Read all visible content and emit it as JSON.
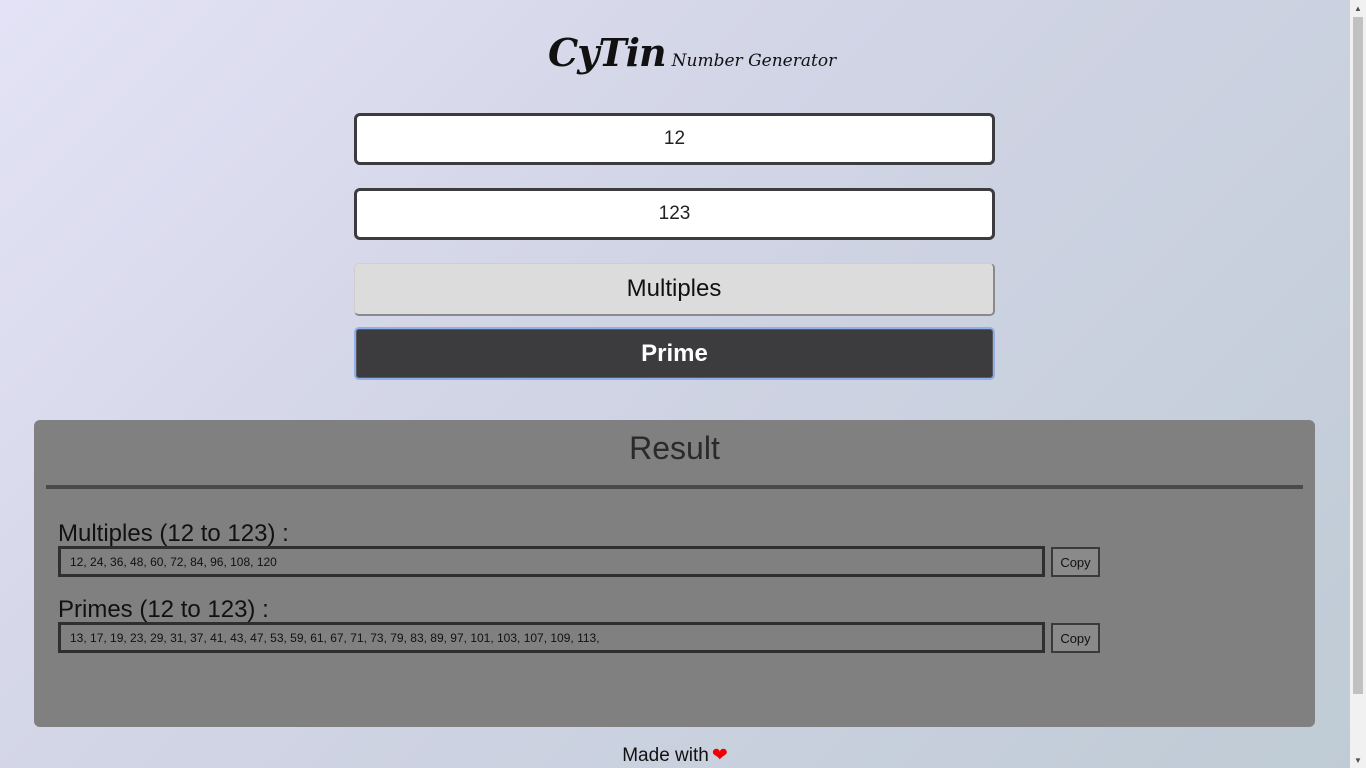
{
  "header": {
    "logo_main": "CyTin",
    "logo_sub": "Number Generator"
  },
  "form": {
    "start_value": "12",
    "end_value": "123",
    "multiples_label": "Multiples",
    "prime_label": "Prime"
  },
  "result": {
    "title": "Result",
    "multiples_label": "Multiples (12 to 123) :",
    "multiples_value": "12, 24, 36, 48, 60, 72, 84, 96, 108, 120",
    "primes_label": "Primes (12 to 123) :",
    "primes_value": "13, 17, 19, 23, 29, 31, 37, 41, 43, 47, 53, 59, 61, 67, 71, 73, 79, 83, 89, 97, 101, 103, 107, 109, 113,",
    "copy_label": "Copy"
  },
  "footer": {
    "text": "Made with",
    "icon": "heart-icon",
    "icon_color": "#ee0000"
  },
  "colors": {
    "prime_button_bg": "#3c3c3e",
    "result_panel_bg": "#808080"
  }
}
